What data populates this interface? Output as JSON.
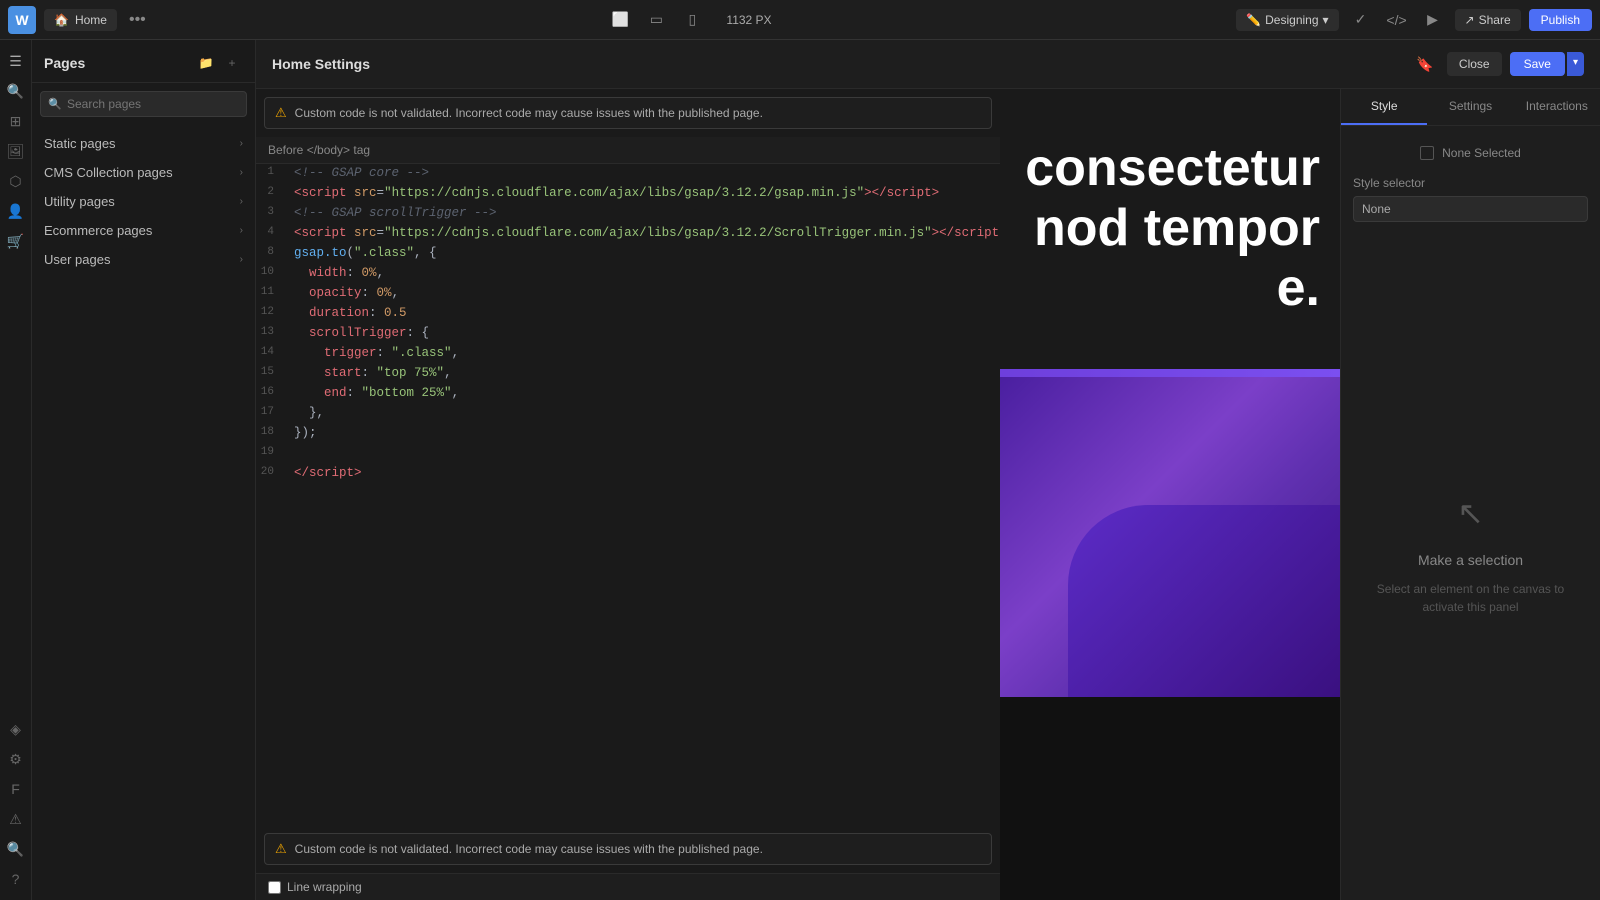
{
  "topbar": {
    "logo": "W",
    "tab_label": "Home",
    "tab_icon": "🏠",
    "dots": "•••",
    "px_label": "1132 PX",
    "designing_label": "Designing",
    "share_label": "Share",
    "publish_label": "Publish"
  },
  "pages_panel": {
    "title": "Pages",
    "search_placeholder": "Search pages",
    "sections": [
      {
        "label": "Static pages",
        "has_arrow": true
      },
      {
        "label": "CMS Collection pages",
        "has_arrow": true
      },
      {
        "label": "Utility pages",
        "has_arrow": true
      },
      {
        "label": "Ecommerce pages",
        "has_arrow": true
      },
      {
        "label": "User pages",
        "has_arrow": true
      }
    ]
  },
  "settings": {
    "title": "Home Settings",
    "close_label": "Close",
    "save_label": "Save"
  },
  "code_editor": {
    "before_body_label": "Before </body> tag",
    "warning_text": "Custom code is not validated. Incorrect code may cause issues with the published page.",
    "lines": [
      {
        "num": 1,
        "content": "<!-- GSAP core -->"
      },
      {
        "num": 2,
        "content": "<script src=\"https://cdnjs.cloudflare.com/ajax/libs/gsap/3.12.2/gsap.min.js\"><\\/script>"
      },
      {
        "num": 3,
        "content": "<!-- GSAP scrollTrigger -->"
      },
      {
        "num": 4,
        "content": "<script src=\"https://cdnjs.cloudflare.com/ajax/libs/gsap/3.12.2/ScrollTrigger.min.js\"><\\/script>"
      },
      {
        "num": 8,
        "content": "gsap.to(\".class\", {"
      },
      {
        "num": 10,
        "content": "  width: 0%,"
      },
      {
        "num": 11,
        "content": "  opacity: 0%,"
      },
      {
        "num": 12,
        "content": "  duration: 0.5"
      },
      {
        "num": 13,
        "content": "  scrollTrigger: {"
      },
      {
        "num": 14,
        "content": "    trigger: \".class\","
      },
      {
        "num": 15,
        "content": "    start: \"top 75%\","
      },
      {
        "num": 16,
        "content": "    end: \"bottom 25%\","
      },
      {
        "num": 17,
        "content": "  },"
      },
      {
        "num": 18,
        "content": "});"
      },
      {
        "num": 19,
        "content": ""
      },
      {
        "num": 20,
        "content": "<\\/script>"
      }
    ],
    "bottom_warning": "Custom code is not validated. Incorrect code may cause issues with the published page.",
    "line_wrap_label": "Line wrapping"
  },
  "canvas": {
    "text_line1": "consectetur",
    "text_line2": "nod tempor",
    "text_line3": "e."
  },
  "right_panel": {
    "tabs": [
      "Style",
      "Settings",
      "Interactions"
    ],
    "active_tab": "Style",
    "none_selected_label": "None Selected",
    "style_selector_label": "Style selector",
    "style_selector_value": "None",
    "make_selection_title": "Make a selection",
    "make_selection_desc": "Select an element on the canvas to activate this panel"
  }
}
